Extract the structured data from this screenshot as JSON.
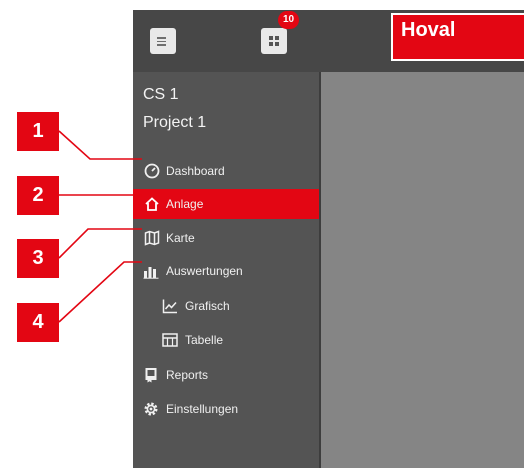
{
  "header": {
    "menu_icon": "hamburger-icon",
    "qr_icon": "qr-code-icon",
    "notification_count": "10",
    "logo_text": "Hoval",
    "brand_color": "#e30613"
  },
  "context": {
    "line1": "CS 1",
    "line2": "Project 1"
  },
  "nav": {
    "items": [
      {
        "label": "Dashboard",
        "icon": "dashboard-gauge-icon"
      },
      {
        "label": "Anlage",
        "icon": "home-icon",
        "active": true
      },
      {
        "label": "Karte",
        "icon": "map-icon"
      },
      {
        "label": "Auswertungen",
        "icon": "bar-chart-icon"
      },
      {
        "label": "Grafisch",
        "icon": "line-chart-icon",
        "sub": true
      },
      {
        "label": "Tabelle",
        "icon": "table-icon",
        "sub": true
      },
      {
        "label": "Reports",
        "icon": "report-book-icon"
      },
      {
        "label": "Einstellungen",
        "icon": "gear-icon"
      }
    ]
  },
  "callouts": [
    "1",
    "2",
    "3",
    "4"
  ],
  "colors": {
    "topbar": "#474747",
    "sidebar": "#545454",
    "content": "#858585",
    "active": "#e30613"
  }
}
